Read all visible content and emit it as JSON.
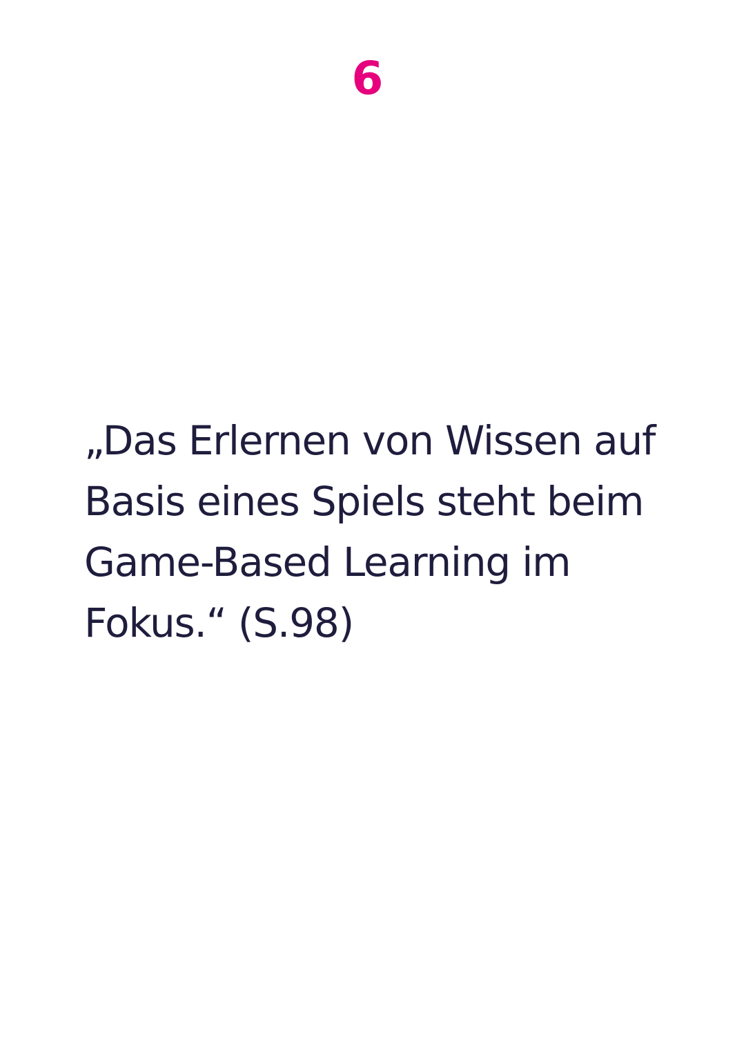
{
  "page": {
    "number": "6"
  },
  "quote": {
    "lines": [
      "„Das Erlernen von Wissen auf",
      "Basis eines Spiels steht beim",
      "Game-Based Learning im",
      "Fokus.“ (S.98)"
    ]
  },
  "colors": {
    "accent": "#e6007e",
    "text": "#1f1d3d",
    "background": "#ffffff"
  }
}
